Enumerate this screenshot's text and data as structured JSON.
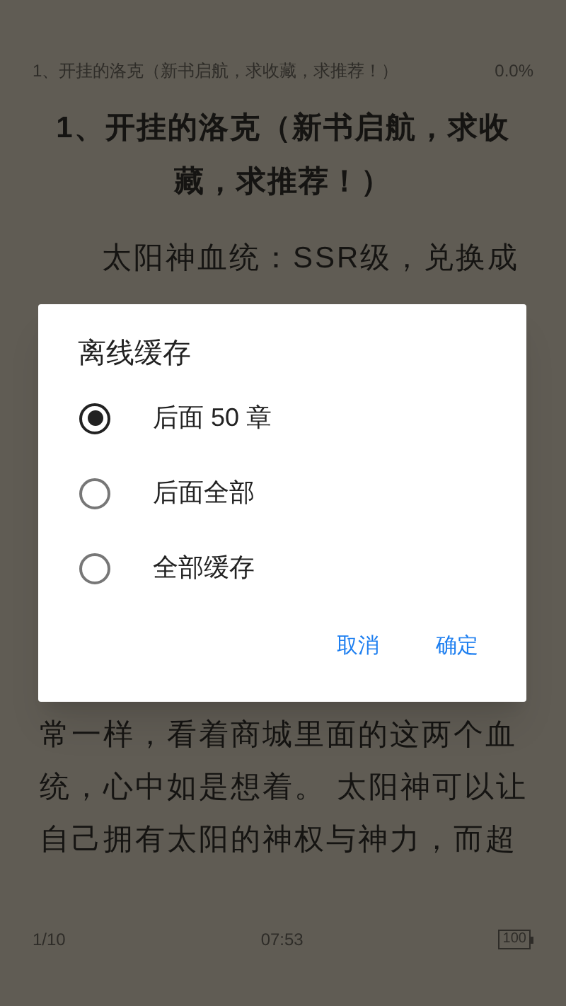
{
  "header": {
    "chapter": "1、开挂的洛克（新书启航，求收藏，求推荐！）",
    "progress": "0.0%"
  },
  "chapter_title": "1、开挂的洛克（新书启航，求收藏，求推荐！）",
  "body_top": [
    "太阳神血统：SSR级，兑换成"
  ],
  "body_bottom": [
    "常一样，看着商城里面的这两个血",
    "统，心中如是想着。 太阳神可以让",
    "自己拥有太阳的神权与神力，而超"
  ],
  "footer": {
    "page": "1/10",
    "time": "07:53",
    "battery": "100"
  },
  "dialog": {
    "title": "离线缓存",
    "options": [
      {
        "label": "后面 50 章",
        "selected": true
      },
      {
        "label": "后面全部",
        "selected": false
      },
      {
        "label": "全部缓存",
        "selected": false
      }
    ],
    "buttons": [
      "取消",
      "确定"
    ]
  }
}
